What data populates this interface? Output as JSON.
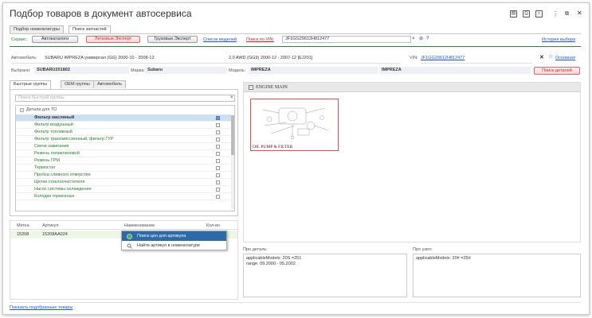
{
  "window": {
    "title": "Подбор товаров в документ автосервиса",
    "title_icons": [
      "save-icon",
      "print-icon",
      "preview-icon",
      "more-icon",
      "restore-icon",
      "close-icon"
    ]
  },
  "tabs": [
    {
      "label": "Подбор номенклатуры",
      "active": false
    },
    {
      "label": "Поиск запчастей",
      "active": true
    }
  ],
  "service_bar": {
    "label": "Сервис:",
    "btn_autocatalogs": "Автокаталоги",
    "btn_light_expert": "Легковые.Эксперт",
    "btn_truck_expert": "Грузовые.Эксперт",
    "link_models": "Список моделей",
    "link_vin": "Поиск по VIN:",
    "vin_value": "JF1GG29612H812477",
    "clear_symbol": "×",
    "link_symbol": "⊘",
    "help_symbol": "?",
    "history_link": "История выбора"
  },
  "car_info": {
    "auto_label": "Автомобиль:",
    "auto_value": "SUBARU IMPREZA универсал (GG) 2000-10 - 2008-12",
    "engine_value": "2.0 AWD (GG9) 2000-12 - 2007-12 [EJ201]",
    "vin_label": "VIN:",
    "vin_link": "JF1GG29612H812477",
    "x_symbol": "✕",
    "star_symbol": "☆",
    "main_link": "Основная"
  },
  "selection": {
    "chosen_label": "Выбрано:",
    "chosen_value": "SUBARU201802",
    "brand_label": "Марка:",
    "brand_value": "Subaru",
    "model_label": "Модель:",
    "model_value": "IMPREZA",
    "model_value2": "IMPREZA",
    "search_button": "Поиск деталей"
  },
  "left_tabs": [
    {
      "label": "Быстрые группы",
      "active": true
    },
    {
      "label": "OEM группы",
      "active": false
    },
    {
      "label": "Автомобиль",
      "active": false
    }
  ],
  "quick_search": {
    "placeholder": "Поиск быстрой группы",
    "clear_symbol": "×"
  },
  "tree": {
    "group_label": "Детали для ТО",
    "items": [
      {
        "label": "Фильтр масляный",
        "selected": true
      },
      {
        "label": "Фильтр воздушный",
        "selected": false
      },
      {
        "label": "Фильтр топливный",
        "selected": false
      },
      {
        "label": "Фильтр трансмиссионный, фильтр ГУР",
        "selected": false
      },
      {
        "label": "Свечи зажигания",
        "selected": false
      },
      {
        "label": "Ремень поликлиновой",
        "selected": false
      },
      {
        "label": "Ремень ГРМ",
        "selected": false
      },
      {
        "label": "Термостат",
        "selected": false
      },
      {
        "label": "Пробка сливного отверстия",
        "selected": false
      },
      {
        "label": "Щетки стеклоочистителя",
        "selected": false
      },
      {
        "label": "Насос системы охлаждения",
        "selected": false
      },
      {
        "label": "Колодки тормозные",
        "selected": false
      }
    ]
  },
  "parts_table": {
    "headers": [
      "Метка",
      "Артикул",
      "Наименование",
      "Кол-во"
    ],
    "rows": [
      {
        "mark": "15208",
        "article": "15208AA024",
        "name": "",
        "qty": ""
      }
    ]
  },
  "context_menu": [
    {
      "label": "Поиск цен для артикула",
      "icon": "price-search-icon",
      "highlighted": true
    },
    {
      "label": "Найти артикул в номенклатуре",
      "icon": "search-icon",
      "highlighted": false
    }
  ],
  "diagram": {
    "section_symbol": "−",
    "section_title": "ENGINE MAIN",
    "card_caption": "OIL PUMP & FILTER"
  },
  "detail_boxes": {
    "part_label": "Про деталь:",
    "part_text": "applicableModels: 20S =251\nrange: 09.2000 - 05.2002",
    "node_label": "Про узел:",
    "node_text": "applicableModels: 20# =25#"
  },
  "footer": {
    "link": "Показать подобранные товары"
  },
  "colors": {
    "accent_green": "#2a8a3a",
    "red": "#d32020",
    "link_blue": "#2255cc",
    "selection": "#cde0f0",
    "menu_highlight": "#2c6aa8"
  }
}
